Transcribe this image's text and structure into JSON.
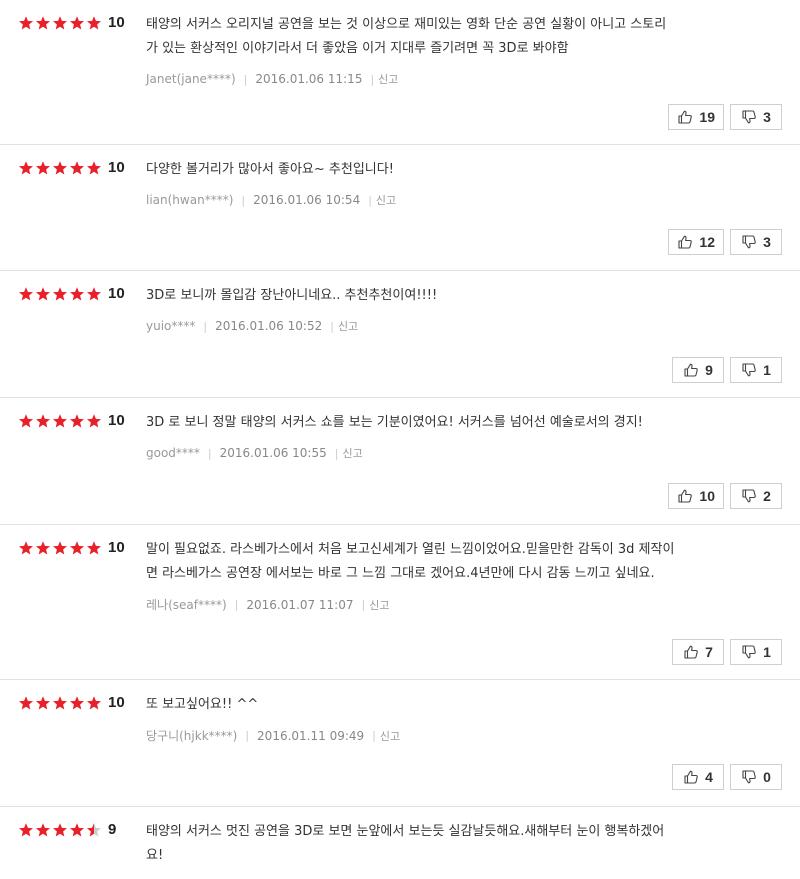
{
  "colors": {
    "star": "#e8202a",
    "star_empty": "#cccccc"
  },
  "reviews": [
    {
      "score": "10",
      "rating": 5,
      "text": "태양의 서커스 오리지널 공연을 보는 것 이상으로 재미있는 영화 단순 공연 실황이 아니고 스토리\n가 있는 환상적인 이야기라서 더 좋았음 이거 지대루 즐기려면 꼭 3D로 봐야함",
      "author": "Janet(jane****)",
      "date": "2016.01.06 11:15",
      "report": "신고",
      "up": "19",
      "down": "3"
    },
    {
      "score": "10",
      "rating": 5,
      "text": "다양한 볼거리가 많아서 좋아요~ 추천입니다!",
      "author": "lian(hwan****)",
      "date": "2016.01.06 10:54",
      "report": "신고",
      "up": "12",
      "down": "3"
    },
    {
      "score": "10",
      "rating": 5,
      "text": "3D로 보니까 몰입감 장난아니네요.. 추천추천이여!!!!",
      "author": "yuio****",
      "date": "2016.01.06 10:52",
      "report": "신고",
      "up": "9",
      "down": "1"
    },
    {
      "score": "10",
      "rating": 5,
      "text": "3D 로 보니 정말 태양의 서커스 쇼를 보는 기분이였어요! 서커스를 넘어선 예술로서의 경지!",
      "author": "good****",
      "date": "2016.01.06 10:55",
      "report": "신고",
      "up": "10",
      "down": "2"
    },
    {
      "score": "10",
      "rating": 5,
      "text": "말이 필요없죠. 라스베가스에서 처음 보고신세계가 열린 느낌이었어요.믿을만한 감독이 3d 제작이\n면 라스베가스 공연장 에서보는 바로 그 느낌 그대로 겠어요.4년만에 다시 감동 느끼고 싶네요.",
      "author": "레나(seaf****)",
      "date": "2016.01.07 11:07",
      "report": "신고",
      "up": "7",
      "down": "1"
    },
    {
      "score": "10",
      "rating": 5,
      "text": "또 보고싶어요!! ^^",
      "author": "당구니(hjkk****)",
      "date": "2016.01.11 09:49",
      "report": "신고",
      "up": "4",
      "down": "0"
    },
    {
      "score": "9",
      "rating": 4.5,
      "text": "태양의 서커스 멋진 공연을 3D로 보면 눈앞에서 보는듯 실감날듯해요.새해부터 눈이 행복하겠어\n요!",
      "author": "",
      "date": "",
      "report": "",
      "up": "",
      "down": ""
    }
  ]
}
